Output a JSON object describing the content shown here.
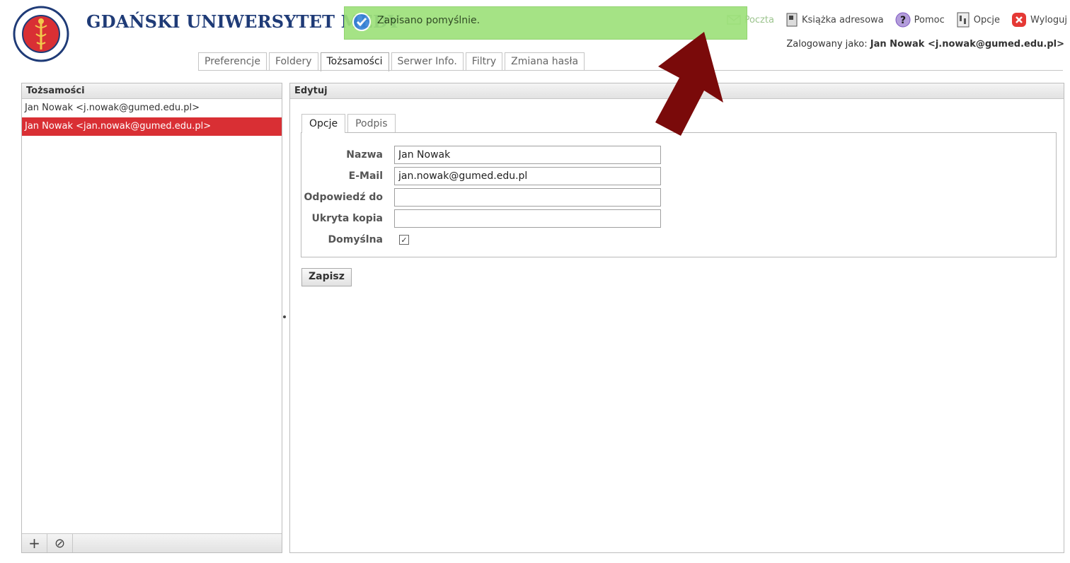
{
  "header": {
    "brand": "GDAŃSKI UNIWERSYTET MEDY",
    "logo_text": "GDAŃSKI UNIWERSYTET MEDYCZNY",
    "nav": [
      {
        "label": "Poczta",
        "icon": "mail-icon"
      },
      {
        "label": "Książka adresowa",
        "icon": "address-book-icon"
      },
      {
        "label": "Pomoc",
        "icon": "help-icon"
      },
      {
        "label": "Opcje",
        "icon": "options-icon"
      },
      {
        "label": "Wyloguj",
        "icon": "logout-icon"
      }
    ],
    "logged_prefix": "Zalogowany jako:",
    "logged_user": "Jan Nowak <j.nowak@gumed.edu.pl>"
  },
  "notification": {
    "message": "Zapisano pomyślnie."
  },
  "tabs": [
    {
      "label": "Preferencje"
    },
    {
      "label": "Foldery"
    },
    {
      "label": "Tożsamości",
      "active": true
    },
    {
      "label": "Serwer Info."
    },
    {
      "label": "Filtry"
    },
    {
      "label": "Zmiana hasła"
    }
  ],
  "identities": {
    "title": "Tożsamości",
    "items": [
      {
        "label": "Jan Nowak <j.nowak@gumed.edu.pl>"
      },
      {
        "label": "Jan Nowak <jan.nowak@gumed.edu.pl>",
        "selected": true
      }
    ],
    "footer": {
      "add": "+",
      "delete": "⊘"
    }
  },
  "edit": {
    "title": "Edytuj",
    "subtabs": [
      {
        "label": "Opcje",
        "active": true
      },
      {
        "label": "Podpis"
      }
    ],
    "fields": {
      "name": {
        "label": "Nazwa",
        "value": "Jan Nowak"
      },
      "email": {
        "label": "E-Mail",
        "value": "jan.nowak@gumed.edu.pl"
      },
      "reply_to": {
        "label": "Odpowiedź do",
        "value": ""
      },
      "bcc": {
        "label": "Ukryta kopia",
        "value": ""
      },
      "default": {
        "label": "Domyślna",
        "checked": true,
        "mark": "✓"
      }
    },
    "save_label": "Zapisz"
  },
  "colors": {
    "selected": "#d92f34",
    "notice": "#9ee17b",
    "brand": "#1f3b77",
    "arrow": "#7a0a0a"
  }
}
